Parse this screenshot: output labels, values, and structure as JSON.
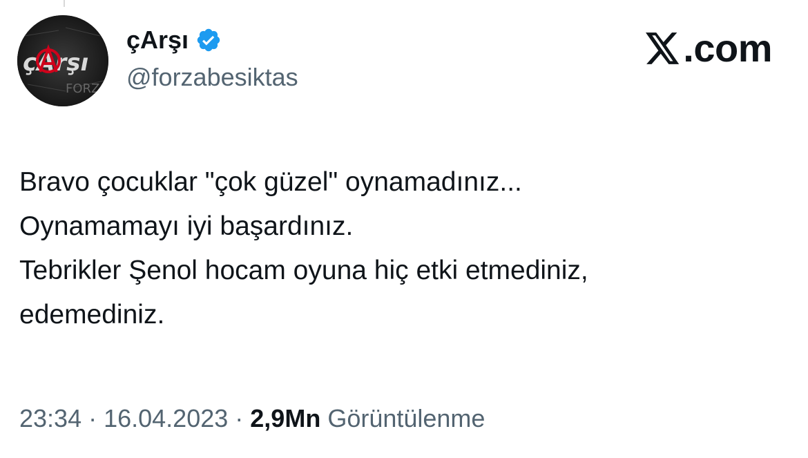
{
  "account": {
    "display_name": "çArşı",
    "handle": "@forzabesiktas",
    "verified": true,
    "avatar_icon": "carsi-avatar",
    "verified_color": "#1d9bf0"
  },
  "brand": {
    "icon": "x-logo-icon",
    "text": ".com"
  },
  "tweet": {
    "lines": [
      "Bravo çocuklar \"çok güzel\" oynamadınız...",
      "Oynamamayı iyi başardınız.",
      "Tebrikler Şenol hocam oyuna hiç etki etmediniz,",
      "edemediniz."
    ]
  },
  "meta": {
    "time": "23:34",
    "separator": "·",
    "date": "16.04.2023",
    "views": "2,9Mn",
    "views_label": "Görüntülenme"
  },
  "colors": {
    "text_primary": "#0f1419",
    "text_secondary": "#536471",
    "background": "#ffffff"
  }
}
